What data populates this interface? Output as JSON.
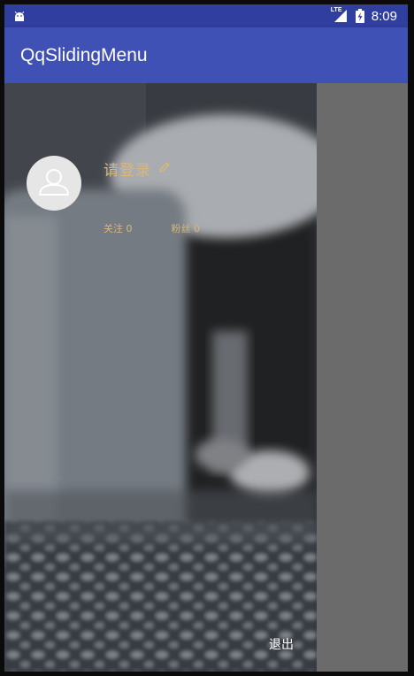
{
  "status_bar": {
    "time": "8:09",
    "network_label": "LTE",
    "icons": [
      "android-icon",
      "lte-signal-icon",
      "battery-charging-icon"
    ]
  },
  "app_bar": {
    "title": "QqSlidingMenu"
  },
  "menu": {
    "avatar_icon": "user-icon",
    "login_text": "请登录",
    "edit_icon": "pencil-icon",
    "follow_label": "关注",
    "follow_count": "0",
    "fans_label": "粉丝",
    "fans_count": "0",
    "logout_label": "退出"
  },
  "colors": {
    "status_bar": "#303f9f",
    "app_bar": "#3f51b5",
    "accent_text": "#d9b77c",
    "overlay": "#6b6b6b"
  }
}
